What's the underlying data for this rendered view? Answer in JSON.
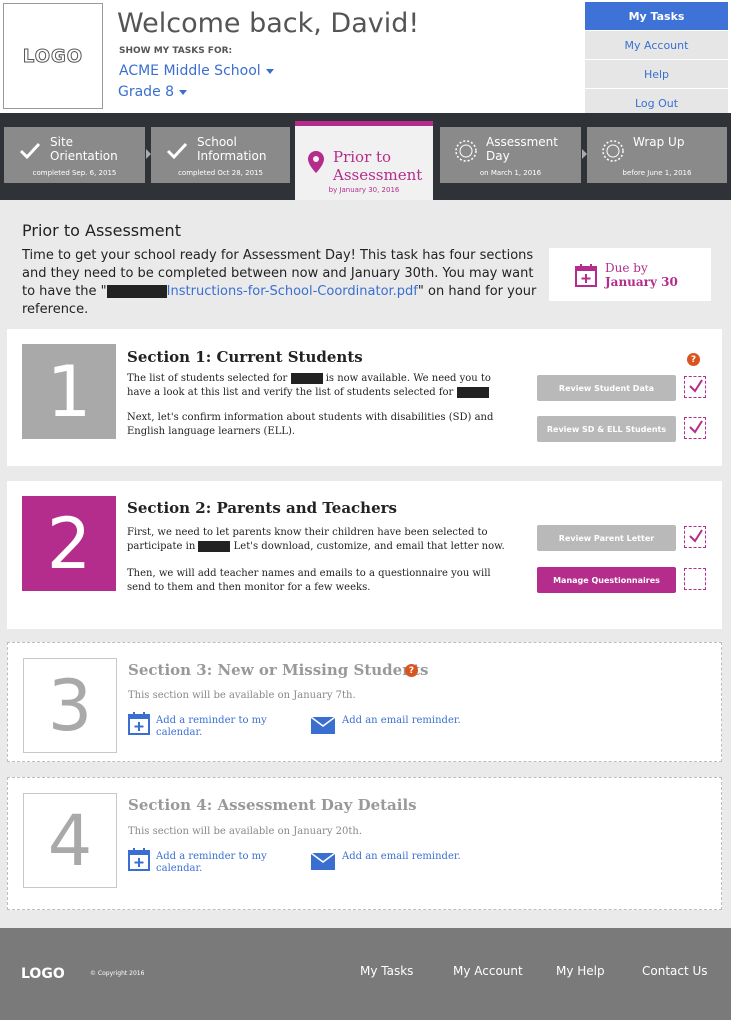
{
  "header": {
    "logo": "LOGO",
    "welcome": "Welcome back, David!",
    "show_label": "SHOW MY TASKS FOR:",
    "school": "ACME Middle School",
    "grade": "Grade 8"
  },
  "topnav": {
    "items": [
      "My Tasks",
      "My Account",
      "Help",
      "Log Out"
    ]
  },
  "progress": {
    "steps": [
      {
        "title_line1": "Site",
        "title_line2": "Orientation",
        "sub": "completed Sep. 6, 2015",
        "status": "completed"
      },
      {
        "title_line1": "School",
        "title_line2": "Information",
        "sub": "completed Oct 28, 2015",
        "status": "completed"
      },
      {
        "title_line1": "Prior to",
        "title_line2": "Assessment",
        "sub": "by January 30, 2016",
        "status": "active"
      },
      {
        "title_line1": "Assessment",
        "title_line2": "Day",
        "sub": "on March 1, 2016",
        "status": "upcoming"
      },
      {
        "title_line1": "Wrap Up",
        "title_line2": "",
        "sub": "before June 1, 2016",
        "status": "upcoming"
      }
    ]
  },
  "main": {
    "title": "Prior to Assessment",
    "intro_part1": "Time to get your school ready for Assessment Day! This task has four sections and they need to be completed between now and January 30th. You may want to have the \"",
    "intro_file": "Instructions-for-School-Coordinator.pdf",
    "intro_part2": "\" on hand for your reference.",
    "due_label": "Due by",
    "due_date": "January 30"
  },
  "sections": {
    "s1": {
      "number": "1",
      "title": "Section 1: Current Students",
      "p1_a": "The list of students selected for",
      "p1_b": "is now available. We need you to have a look at this list and verify the list of students selected for",
      "p2": "Next, let's confirm information about students with disabilities (SD) and English language learners (ELL).",
      "btn1": "Review Student Data",
      "btn2": "Review SD & ELL Students",
      "help": "?"
    },
    "s2": {
      "number": "2",
      "title": "Section 2: Parents and Teachers",
      "p1_a": "First, we need to let parents know their children have been selected to participate in",
      "p1_b": "Let's download, customize, and email that letter now.",
      "p2": "Then, we will add teacher names and emails to a questionnaire you will send to them and then monitor for a few weeks.",
      "btn1": "Review Parent Letter",
      "btn2": "Manage Questionnaires"
    },
    "s3": {
      "number": "3",
      "title": "Section 3: New or Missing Students",
      "availability": "This section will be available on January 7th.",
      "calendar_reminder": "Add a reminder to my calendar.",
      "email_reminder": "Add an email reminder.",
      "help": "?"
    },
    "s4": {
      "number": "4",
      "title": "Section 4: Assessment Day Details",
      "availability": "This section will be available on January 20th.",
      "calendar_reminder": "Add a reminder to my calendar.",
      "email_reminder": "Add an email reminder."
    }
  },
  "footer": {
    "logo": "LOGO",
    "copyright": "© Copyright 2016",
    "links": [
      "My Tasks",
      "My Account",
      "My Help",
      "Contact Us"
    ]
  },
  "colors": {
    "accent": "#b42d8c",
    "link": "#3a6fd1",
    "active_nav": "#3f72d6",
    "help": "#d9541e"
  }
}
